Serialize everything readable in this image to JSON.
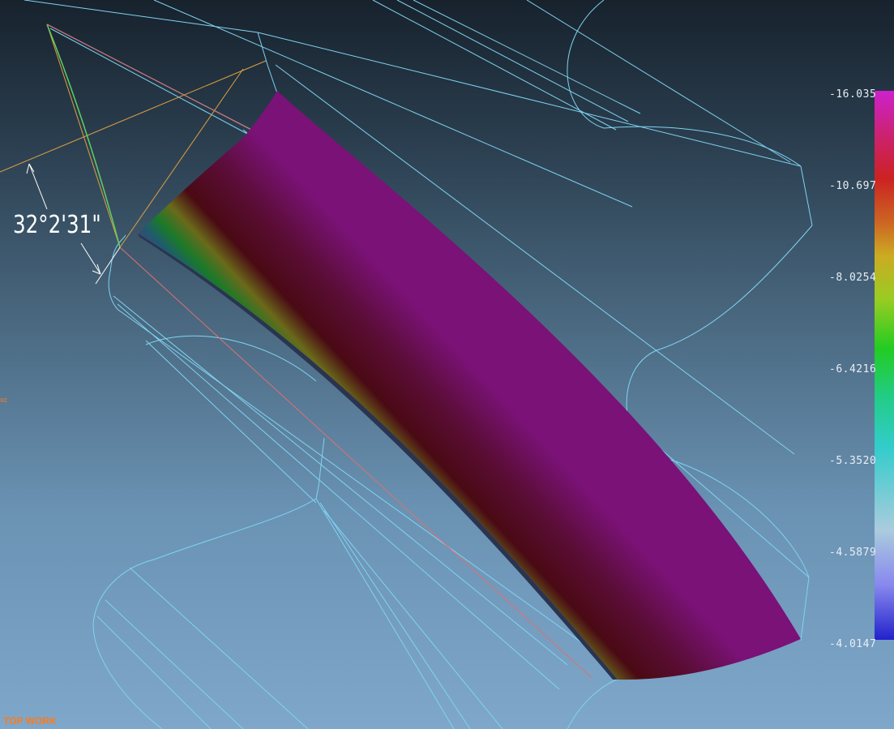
{
  "viewport": {
    "view_label": "TOP WORK",
    "axis_tick": "xc"
  },
  "dimension": {
    "angle_text": "32°2'31\""
  },
  "legend": {
    "labels": [
      "-16.035",
      "-10.697",
      "-8.0254",
      "-6.4216",
      "-5.3520",
      "-4.5879",
      "-4.0147"
    ],
    "colors": [
      "#cc22cc",
      "#cc2222",
      "#ccaa22",
      "#22cc22",
      "#33cccc",
      "#aaccdd",
      "#2222cc"
    ]
  },
  "colors": {
    "wireframe": "#7fd4f2",
    "construction": "#e0a040",
    "highlight_green": "#5ed060",
    "highlight_red": "#e07070",
    "surface_top": "#7a1277",
    "surface_mid": "#4a0a14",
    "surface_band_yellow": "#6a6a1a",
    "surface_band_green": "#1a7a2a",
    "surface_band_teal": "#1f5a70"
  }
}
